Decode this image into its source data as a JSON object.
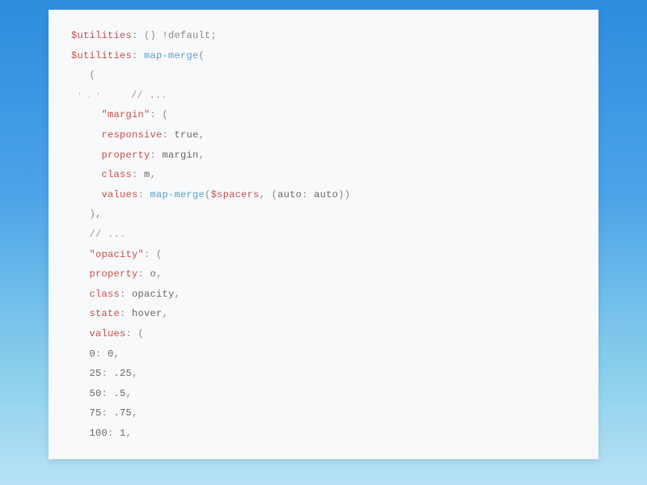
{
  "code": {
    "line1": {
      "variable": "$utilities",
      "colon": ": ",
      "paren": "()",
      "default": " !default",
      "semi": ";"
    },
    "line2": {
      "variable": "$utilities",
      "colon": ": ",
      "function": "map-merge",
      "paren": "("
    },
    "line3": {
      "indent": "   ",
      "paren": "("
    },
    "line4_annotation": "' . '",
    "line4": {
      "indent": "     ",
      "comment": "// ..."
    },
    "line5": {
      "indent": "     ",
      "string": "\"margin\"",
      "colon": ": ",
      "paren": "("
    },
    "line6": {
      "indent": "     ",
      "property": "responsive",
      "colon": ": ",
      "value": "true",
      "comma": ","
    },
    "line7": {
      "indent": "     ",
      "property": "property",
      "colon": ": ",
      "value": "margin",
      "comma": ","
    },
    "line8": {
      "indent": "     ",
      "property": "class",
      "colon": ": ",
      "value": "m",
      "comma": ","
    },
    "line9": {
      "indent": "     ",
      "property": "values",
      "colon": ": ",
      "function": "map-merge",
      "paren_open": "(",
      "variable": "$spacers",
      "comma": ", ",
      "nested_open": "(",
      "nested_key": "auto",
      "nested_colon": ": ",
      "nested_val": "auto",
      "nested_close": ")",
      "paren_close": ")"
    },
    "line10": {
      "indent": "   ",
      "paren": ")",
      "comma": ","
    },
    "line11": {
      "indent": "   ",
      "comment": "// ..."
    },
    "line12": {
      "indent": "   ",
      "string": "\"opacity\"",
      "colon": ": ",
      "paren": "("
    },
    "line13": {
      "indent": "   ",
      "property": "property",
      "colon": ": ",
      "value": "o",
      "comma": ","
    },
    "line14": {
      "indent": "   ",
      "property": "class",
      "colon": ": ",
      "value": "opacity",
      "comma": ","
    },
    "line15": {
      "indent": "   ",
      "property": "state",
      "colon": ": ",
      "value": "hover",
      "comma": ","
    },
    "line16": {
      "indent": "   ",
      "property": "values",
      "colon": ": ",
      "paren": "("
    },
    "line17": {
      "indent": "   ",
      "key": "0",
      "colon": ": ",
      "value": "0",
      "comma": ","
    },
    "line18": {
      "indent": "   ",
      "key": "25",
      "colon": ": ",
      "value": ".25",
      "comma": ","
    },
    "line19": {
      "indent": "   ",
      "key": "50",
      "colon": ": ",
      "value": ".5",
      "comma": ","
    },
    "line20": {
      "indent": "   ",
      "key": "75",
      "colon": ": ",
      "value": ".75",
      "comma": ","
    },
    "line21": {
      "indent": "   ",
      "key": "100",
      "colon": ": ",
      "value": "1",
      "comma": ","
    }
  }
}
